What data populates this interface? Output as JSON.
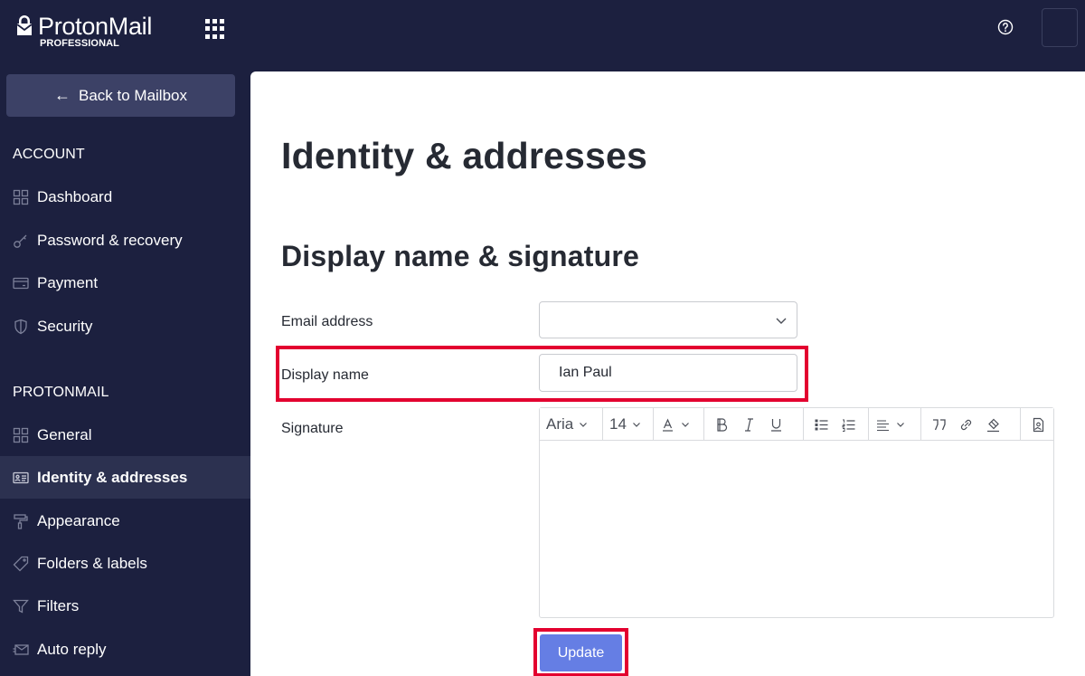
{
  "header": {
    "brand_name": "ProtonMail",
    "brand_plan": "PROFESSIONAL",
    "apps_icon": "grid-icon",
    "help_icon": "question-circle-icon"
  },
  "sidebar": {
    "back_label": "Back to Mailbox",
    "sections": [
      {
        "title": "ACCOUNT",
        "items": [
          {
            "label": "Dashboard",
            "icon": "dashboard-icon"
          },
          {
            "label": "Password & recovery",
            "icon": "key-icon"
          },
          {
            "label": "Payment",
            "icon": "credit-card-icon"
          },
          {
            "label": "Security",
            "icon": "shield-icon"
          }
        ]
      },
      {
        "title": "PROTONMAIL",
        "items": [
          {
            "label": "General",
            "icon": "dashboard-icon"
          },
          {
            "label": "Identity & addresses",
            "icon": "id-card-icon",
            "active": true
          },
          {
            "label": "Appearance",
            "icon": "paint-roller-icon"
          },
          {
            "label": "Folders & labels",
            "icon": "tag-icon"
          },
          {
            "label": "Filters",
            "icon": "filter-icon"
          },
          {
            "label": "Auto reply",
            "icon": "envelope-icon"
          }
        ]
      }
    ]
  },
  "main": {
    "page_title": "Identity & addresses",
    "section_title": "Display name & signature",
    "email_label": "Email address",
    "email_value": "",
    "display_name_label": "Display name",
    "display_name_value": "Ian Paul",
    "signature_label": "Signature",
    "editor": {
      "font": "Aria",
      "size": "14",
      "tools": [
        "text-color",
        "bold",
        "italic",
        "underline",
        "bullet-list",
        "numbered-list",
        "align",
        "blockquote",
        "link",
        "clear-formatting",
        "insert-image"
      ]
    },
    "update_label": "Update"
  },
  "colors": {
    "sidebar_bg": "#1c203f",
    "active_item_bg": "#2c3150",
    "back_button_bg": "#3c4166",
    "primary_button": "#657ee4",
    "highlight_border": "#e3002f"
  }
}
